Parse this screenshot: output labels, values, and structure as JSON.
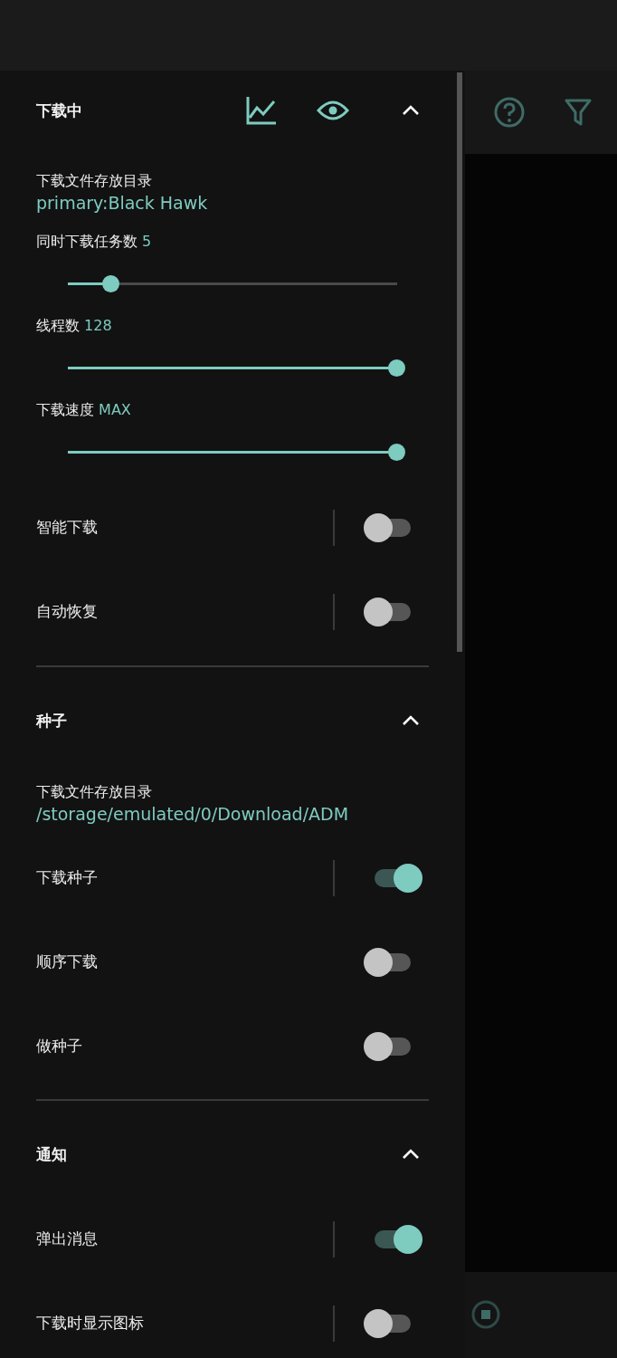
{
  "sections": [
    {
      "title": "下载中",
      "buttons": [
        {
          "kind": "chart"
        },
        {
          "kind": "eye"
        }
      ],
      "expanded": true,
      "items": [
        {
          "kind": "directory",
          "label": "下载文件存放目录",
          "value": "primary:Black Hawk"
        },
        {
          "kind": "slider",
          "label": "同时下载任务数",
          "value": "5",
          "level": 0.13
        },
        {
          "kind": "slider",
          "label": "线程数",
          "value": "128",
          "level": 1
        },
        {
          "kind": "slider",
          "label": "下载速度",
          "value": "MAX",
          "level": 1
        },
        {
          "kind": "toggle",
          "label": "智能下载",
          "on": false,
          "separator": true
        },
        {
          "kind": "toggle",
          "label": "自动恢复",
          "on": false,
          "separator": true
        }
      ]
    },
    {
      "title": "种子",
      "expanded": true,
      "items": [
        {
          "kind": "directory",
          "label": "下载文件存放目录",
          "value": "/storage/emulated/0/Download/ADM"
        },
        {
          "kind": "toggle",
          "label": "下载种子",
          "on": true,
          "separator": true
        },
        {
          "kind": "toggle",
          "label": "顺序下载",
          "on": false,
          "separator": false
        },
        {
          "kind": "toggle",
          "label": "做种子",
          "on": false,
          "separator": false
        }
      ]
    },
    {
      "title": "通知",
      "expanded": true,
      "items": [
        {
          "kind": "toggle",
          "label": "弹出消息",
          "on": true,
          "separator": true
        },
        {
          "kind": "toggle",
          "label": "下载时显示图标",
          "on": false,
          "separator": true
        }
      ]
    }
  ]
}
